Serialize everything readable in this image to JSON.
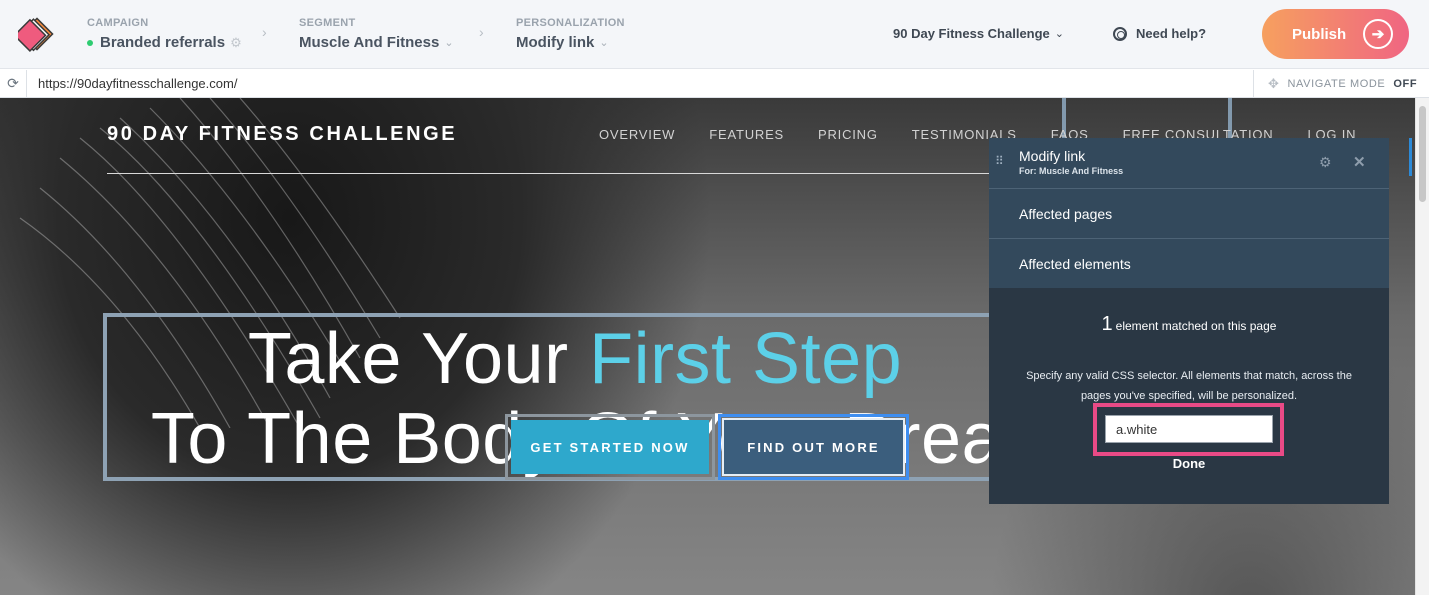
{
  "topbar": {
    "logo_icon": "stacked-layers-logo",
    "campaign": {
      "label": "CAMPAIGN",
      "value": "Branded referrals",
      "status_color": "#2ecc71"
    },
    "segment": {
      "label": "SEGMENT",
      "value": "Muscle And Fitness"
    },
    "personalization": {
      "label": "PERSONALIZATION",
      "value": "Modify link"
    },
    "project": "90 Day Fitness Challenge",
    "help": "Need help?",
    "publish": "Publish",
    "publish_gradient": [
      "#f6a05f",
      "#f06582"
    ]
  },
  "urlbar": {
    "url": "https://90dayfitnesschallenge.com/",
    "navigate_mode_label": "NAVIGATE MODE",
    "navigate_mode_value": "OFF"
  },
  "site": {
    "brand": "90 DAY FITNESS CHALLENGE",
    "nav": [
      "OVERVIEW",
      "FEATURES",
      "PRICING",
      "TESTIMONIALS",
      "FAQS",
      "FREE CONSULTATION",
      "LOG IN"
    ],
    "headline_part1": "Take Your ",
    "headline_accent": "First Step",
    "headline_line2": "To The Body Of Your Dreams",
    "accent_color": "#5cd0e8",
    "cta_primary": "GET STARTED NOW",
    "cta_secondary": "FIND OUT MORE"
  },
  "panel": {
    "title": "Modify link",
    "subtitle": "For: Muscle And Fitness",
    "affected_pages": "Affected pages",
    "affected_elements": "Affected elements",
    "match_count": "1",
    "match_text": "element matched on this page",
    "description": "Specify any valid CSS selector. All elements that match, across the pages you've specified, will be personalized.",
    "selector_value": "a.white",
    "done": "Done",
    "highlight_color": "#e94a86"
  }
}
